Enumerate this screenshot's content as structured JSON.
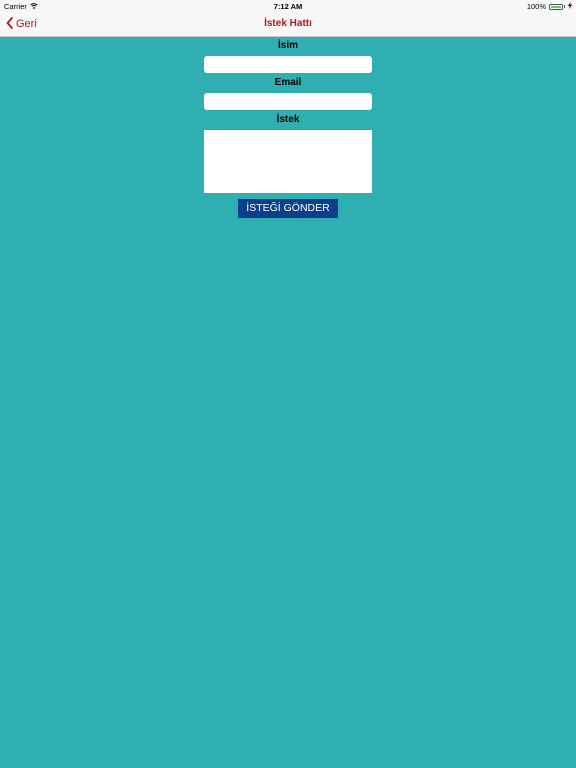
{
  "status_bar": {
    "carrier": "Carrier",
    "time": "7:12 AM",
    "battery": "100%",
    "battery_color": "#4cd964"
  },
  "nav": {
    "back_label": "Geri",
    "title": "İstek Hattı",
    "tint_color": "#b3171d"
  },
  "form": {
    "name_label": "İsim",
    "name_value": "",
    "email_label": "Email",
    "email_value": "",
    "request_label": "İstek",
    "request_value": "",
    "submit_label": "İSTEĞİ GÖNDER",
    "submit_color": "#0b3f8c"
  },
  "background_color": "#2fafb2"
}
